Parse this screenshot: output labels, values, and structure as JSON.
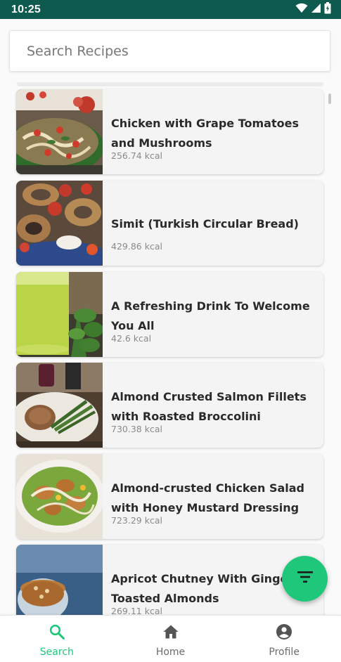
{
  "status_bar": {
    "time": "10:25",
    "icons": [
      "wifi-icon",
      "signal-icon",
      "battery-icon"
    ]
  },
  "search": {
    "placeholder": "Search Recipes",
    "value": ""
  },
  "recipes": [
    {
      "title": "Chicken with Grape Tomatoes and Mushrooms",
      "kcal": "256.74 kcal"
    },
    {
      "title": "Simit (Turkish Circular Bread)",
      "kcal": "429.86 kcal"
    },
    {
      "title": "A Refreshing Drink To Welcome You All",
      "kcal": "42.6 kcal"
    },
    {
      "title": "Almond Crusted Salmon Fillets with Roasted Broccolini",
      "kcal": "730.38 kcal"
    },
    {
      "title": "Almond-crusted Chicken Salad with Honey Mustard Dressing",
      "kcal": "723.29 kcal"
    },
    {
      "title": "Apricot Chutney With Ginger Toasted Almonds",
      "kcal": "269.11 kcal"
    }
  ],
  "fab": {
    "icon": "filter-icon"
  },
  "bottom_nav": {
    "items": [
      {
        "label": "Search",
        "icon": "search-icon",
        "active": true
      },
      {
        "label": "Home",
        "icon": "home-icon",
        "active": false
      },
      {
        "label": "Profile",
        "icon": "profile-icon",
        "active": false
      }
    ]
  },
  "colors": {
    "status_bar": "#0e5a4f",
    "accent": "#1ec779",
    "card_bg": "#f4f4f4",
    "title_text": "#2a2a2a",
    "kcal_text": "#8a8a8a"
  }
}
